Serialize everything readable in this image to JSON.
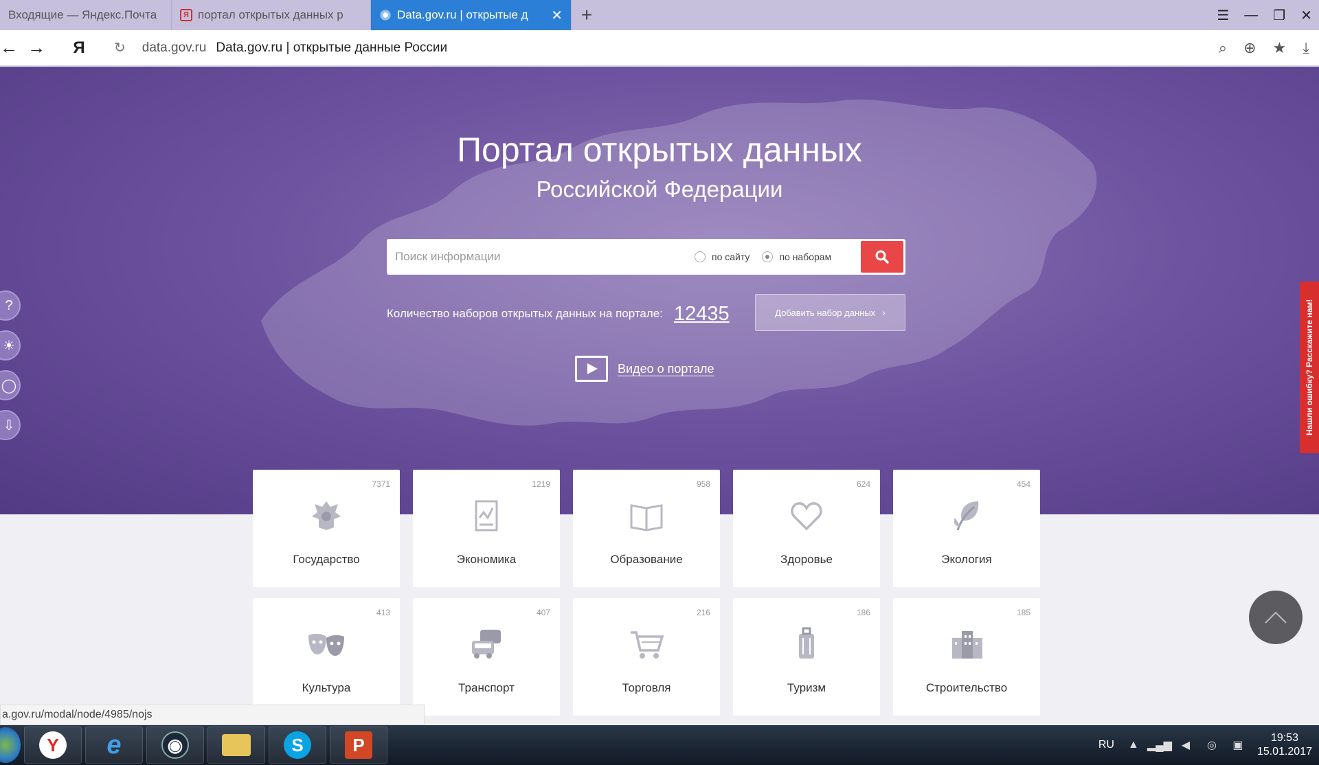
{
  "browser": {
    "tabs": [
      {
        "label": "Входящие — Яндекс.Почта"
      },
      {
        "label": "портал открытых данных р"
      },
      {
        "label": "Data.gov.ru | открытые д"
      }
    ],
    "new_tab": "+",
    "address": {
      "domain": "data.gov.ru",
      "title": "Data.gov.ru | открытые данные России"
    },
    "yandex_glyph": "Я"
  },
  "hero": {
    "title": "Портал открытых данных",
    "subtitle": "Российской Федерации",
    "search": {
      "placeholder": "Поиск информации",
      "options": [
        "по сайту",
        "по наборам"
      ],
      "selected": "по наборам"
    },
    "count_label": "Количество наборов открытых данных на портале:",
    "count_value": "12435",
    "add_button": "Добавить набор данных",
    "video_label": "Видео о портале",
    "feedback": "Нашли ошибку? Расскажите нам!"
  },
  "categories": [
    {
      "name": "Государство",
      "count": "7371",
      "icon": "emblem-icon"
    },
    {
      "name": "Экономика",
      "count": "1219",
      "icon": "report-icon"
    },
    {
      "name": "Образование",
      "count": "958",
      "icon": "book-icon"
    },
    {
      "name": "Здоровье",
      "count": "624",
      "icon": "heart-icon"
    },
    {
      "name": "Экология",
      "count": "454",
      "icon": "leaf-icon"
    },
    {
      "name": "Культура",
      "count": "413",
      "icon": "theater-masks-icon"
    },
    {
      "name": "Транспорт",
      "count": "407",
      "icon": "cars-icon"
    },
    {
      "name": "Торговля",
      "count": "216",
      "icon": "cart-icon"
    },
    {
      "name": "Туризм",
      "count": "186",
      "icon": "luggage-icon"
    },
    {
      "name": "Строительство",
      "count": "185",
      "icon": "building-icon"
    }
  ],
  "status_url": "a.gov.ru/modal/node/4985/nojs",
  "taskbar": {
    "lang": "RU",
    "time": "19:53",
    "date": "15.01.2017"
  },
  "colors": {
    "hero": "#6e54a0",
    "accent": "#e94747",
    "active_tab": "#2c7fd6"
  }
}
